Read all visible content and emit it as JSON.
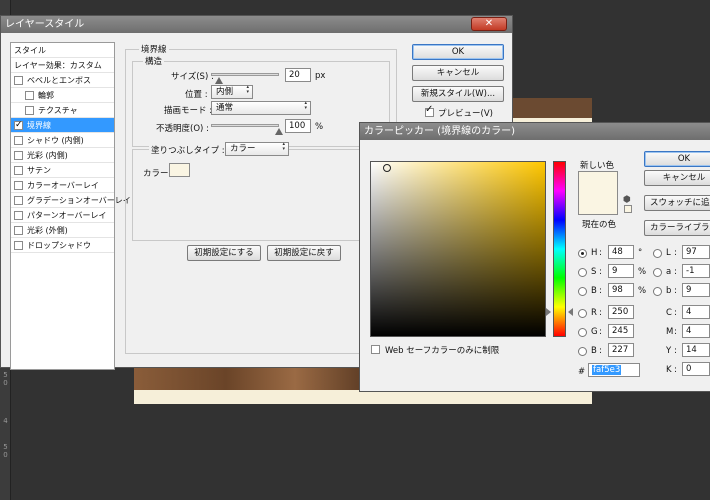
{
  "ruler": {
    "ticks": [
      "5",
      "0",
      "4",
      "5",
      "0"
    ]
  },
  "layer_style": {
    "title": "レイヤースタイル",
    "close": "✕",
    "styles_header": "スタイル",
    "blend_options": "レイヤー効果：カスタム",
    "items": [
      {
        "label": "ベベルとエンボス",
        "checked": false
      },
      {
        "label": "輪郭",
        "checked": false
      },
      {
        "label": "テクスチャ",
        "checked": false
      },
      {
        "label": "境界線",
        "checked": true
      },
      {
        "label": "シャドウ (内側)",
        "checked": false
      },
      {
        "label": "光彩 (内側)",
        "checked": false
      },
      {
        "label": "サテン",
        "checked": false
      },
      {
        "label": "カラーオーバーレイ",
        "checked": false
      },
      {
        "label": "グラデーションオーバーレイ",
        "checked": false
      },
      {
        "label": "パターンオーバーレイ",
        "checked": false
      },
      {
        "label": "光彩 (外側)",
        "checked": false
      },
      {
        "label": "ドロップシャドウ",
        "checked": false
      }
    ],
    "stroke": {
      "section": "境界線",
      "structure": "構造",
      "size_label": "サイズ(S) :",
      "size_value": "20",
      "size_unit": "px",
      "size_level": 0.12,
      "position_label": "位置 :",
      "position_value": "内側",
      "blend_label": "描画モード :",
      "blend_value": "通常",
      "opacity_label": "不透明度(O) :",
      "opacity_value": "100",
      "opacity_unit": "%",
      "opacity_level": 1.0,
      "fill_type_label": "塗りつぶしタイプ :",
      "fill_type_value": "カラー",
      "color_label": "カラー :",
      "color": "#faf5e3"
    },
    "set_default": "初期設定にする",
    "reset_default": "初期設定に戻す",
    "buttons": {
      "ok": "OK",
      "cancel": "キャンセル",
      "new_style": "新規スタイル(W)...",
      "preview": "プレビュー(V)"
    }
  },
  "color_picker": {
    "title": "カラーピッカー (境界線のカラー)",
    "new_label": "新しい色",
    "current_label": "現在の色",
    "new_color": "#faf5e3",
    "current_color": "#faf5e3",
    "ok": "OK",
    "cancel": "キャンセル",
    "add_swatch": "スウォッチに追加",
    "libraries": "カラーライブラリ",
    "web_only": "Web セーフカラーのみに制限",
    "hsb": [
      {
        "key": "H",
        "value": "48",
        "unit": "°",
        "selected": true
      },
      {
        "key": "S",
        "value": "9",
        "unit": "%",
        "selected": false
      },
      {
        "key": "B",
        "value": "98",
        "unit": "%",
        "selected": false
      }
    ],
    "rgb": [
      {
        "key": "R",
        "value": "250"
      },
      {
        "key": "G",
        "value": "245"
      },
      {
        "key": "B",
        "value": "227"
      }
    ],
    "lab": [
      {
        "key": "L",
        "value": "97"
      },
      {
        "key": "a",
        "value": "-1"
      },
      {
        "key": "b",
        "value": "9"
      }
    ],
    "cmyk": [
      {
        "key": "C",
        "value": "4"
      },
      {
        "key": "M",
        "value": "4"
      },
      {
        "key": "Y",
        "value": "14"
      },
      {
        "key": "K",
        "value": "0"
      }
    ],
    "hex_label": "#",
    "hex_value": "faf5e3"
  }
}
